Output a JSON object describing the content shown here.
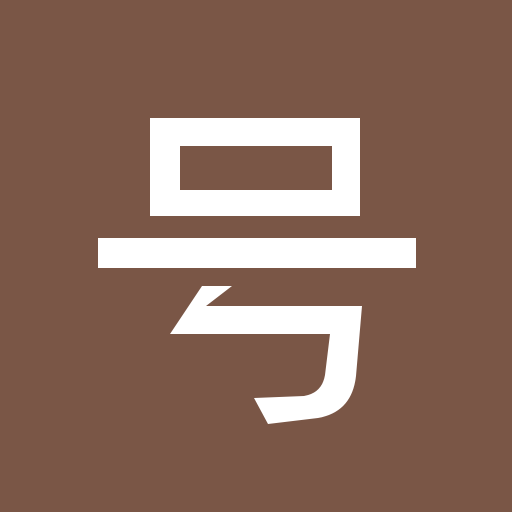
{
  "icon": {
    "glyph": "号",
    "name": "hao-character-icon",
    "background_color": "#7a5646",
    "glyph_color": "#ffffff"
  }
}
